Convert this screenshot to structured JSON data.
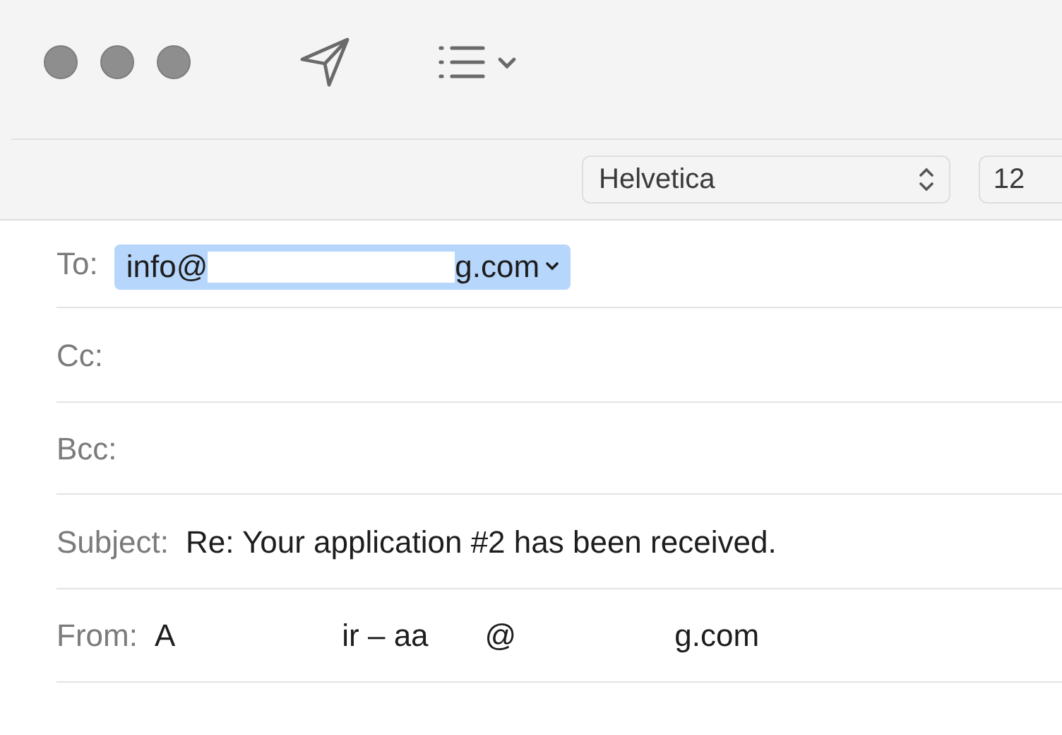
{
  "toolbar": {
    "font_menu": {
      "value": "Helvetica"
    },
    "font_size": {
      "value": "12"
    }
  },
  "headers": [
    {
      "kind": "token",
      "label": "To:",
      "parts": [
        "info@",
        "g.com"
      ]
    },
    {
      "kind": "empty",
      "label": "Cc:"
    },
    {
      "kind": "empty",
      "label": "Bcc:"
    },
    {
      "kind": "text",
      "label": "Subject:",
      "value": "Re: Your application #2 has been received."
    },
    {
      "kind": "redacted",
      "label": "From:",
      "parts": [
        "A",
        "ir – aa",
        "@",
        "g.com"
      ]
    }
  ]
}
